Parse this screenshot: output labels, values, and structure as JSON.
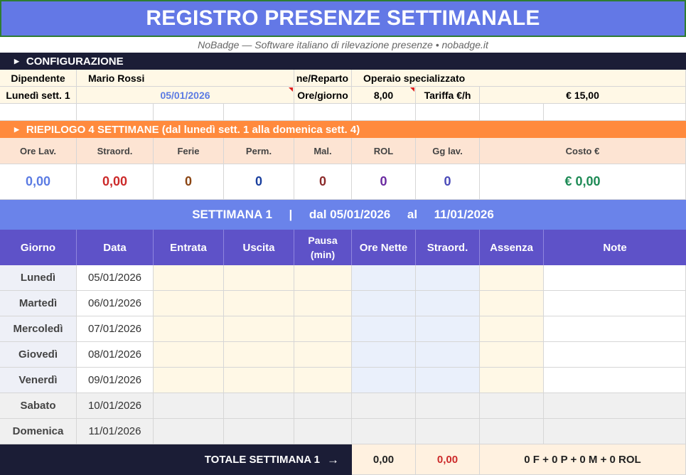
{
  "title": "REGISTRO PRESENZE SETTIMANALE",
  "subtitle": "NoBadge — Software italiano di rilevazione presenze • nobadge.it",
  "config": {
    "header": "CONFIGURAZIONE",
    "employee_label": "Dipendente",
    "employee_value": "Mario Rossi",
    "dept_label": "ne/Reparto",
    "dept_value": "Operaio specializzato",
    "monday_label": "Lunedì sett. 1",
    "monday_value": "05/01/2026",
    "hours_label": "Ore/giorno",
    "hours_value": "8,00",
    "rate_label": "Tariffa €/h",
    "rate_value": "€ 15,00"
  },
  "summary": {
    "header": "RIEPILOGO 4 SETTIMANE (dal lunedì sett. 1 alla domenica sett. 4)",
    "columns": [
      "Ore Lav.",
      "Straord.",
      "Ferie",
      "Perm.",
      "Mal.",
      "ROL",
      "Gg lav.",
      "Costo €"
    ],
    "values": [
      "0,00",
      "0,00",
      "0",
      "0",
      "0",
      "0",
      "0",
      "€ 0,00"
    ],
    "colors": [
      "#5b7be3",
      "#cc2a2a",
      "#8b4513",
      "#1a3f9e",
      "#8b2a2a",
      "#6a2aa0",
      "#4a4ab8",
      "#1d8a55"
    ]
  },
  "week": {
    "banner": "SETTIMANA 1     |     dal 05/01/2026     al     11/01/2026",
    "columns": [
      "Giorno",
      "Data",
      "Entrata",
      "Uscita",
      "Pausa\n(min)",
      "Ore Nette",
      "Straord.",
      "Assenza",
      "Note"
    ],
    "days": [
      {
        "name": "Lunedì",
        "date": "05/01/2026"
      },
      {
        "name": "Martedì",
        "date": "06/01/2026"
      },
      {
        "name": "Mercoledì",
        "date": "07/01/2026"
      },
      {
        "name": "Giovedì",
        "date": "08/01/2026"
      },
      {
        "name": "Venerdì",
        "date": "09/01/2026"
      },
      {
        "name": "Sabato",
        "date": "10/01/2026"
      },
      {
        "name": "Domenica",
        "date": "11/01/2026"
      }
    ],
    "totals": {
      "label": "TOTALE SETTIMANA 1",
      "arrow": "→",
      "ore_nette": "0,00",
      "straord": "0,00",
      "assenze": "0 F + 0 P + 0 M + 0 ROL"
    }
  },
  "colors": {
    "title_bg": "#6378e6",
    "section_dark": "#1b1d36",
    "section_orange": "#ff8a3d",
    "header_purple": "#5e52c8"
  }
}
